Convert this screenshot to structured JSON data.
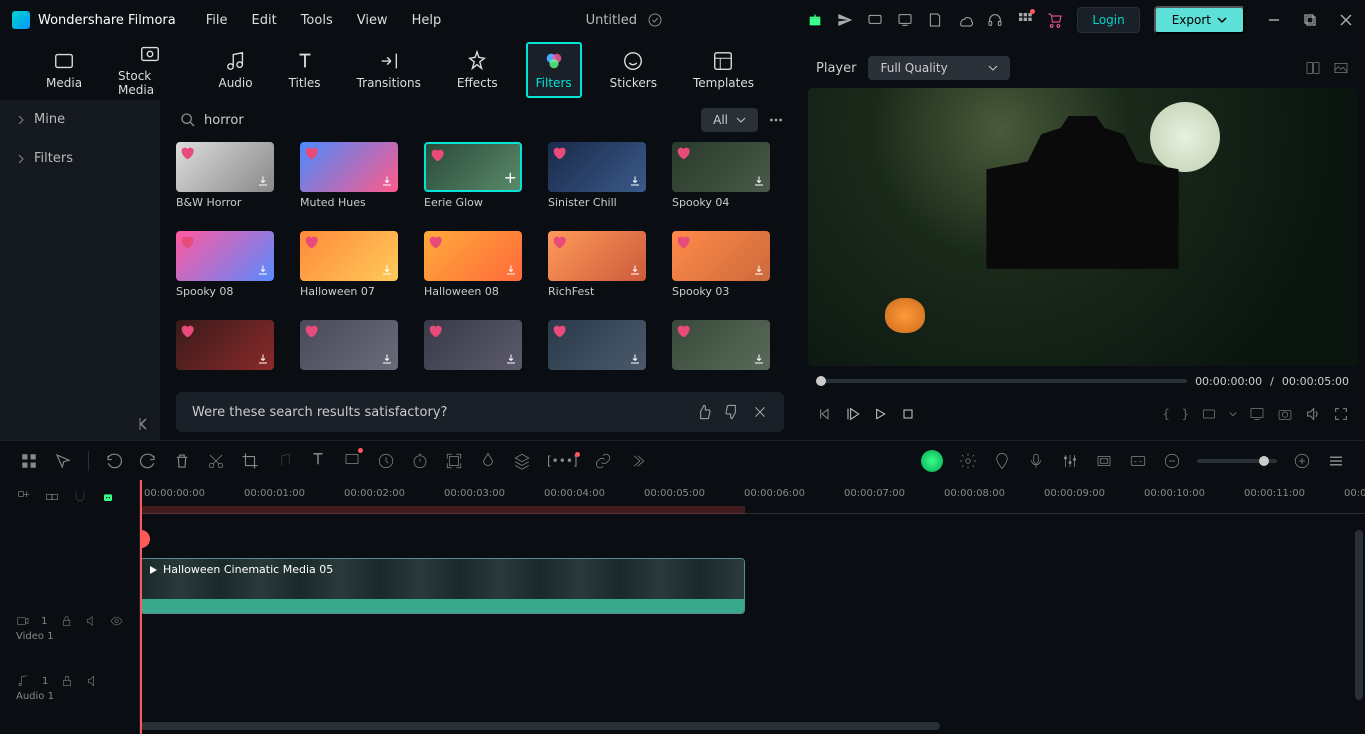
{
  "app": {
    "name": "Wondershare Filmora"
  },
  "menu": {
    "file": "File",
    "edit": "Edit",
    "tools": "Tools",
    "view": "View",
    "help": "Help"
  },
  "project": {
    "title": "Untitled"
  },
  "header": {
    "login": "Login",
    "export": "Export"
  },
  "tabs": {
    "media": "Media",
    "stock_media": "Stock Media",
    "audio": "Audio",
    "titles": "Titles",
    "transitions": "Transitions",
    "effects": "Effects",
    "filters": "Filters",
    "stickers": "Stickers",
    "templates": "Templates"
  },
  "sidebar": {
    "mine": "Mine",
    "filters": "Filters"
  },
  "search": {
    "query": "horror",
    "filter_all": "All"
  },
  "filters_grid": [
    {
      "label": "B&W Horror"
    },
    {
      "label": "Muted Hues"
    },
    {
      "label": "Eerie Glow",
      "selected": true
    },
    {
      "label": "Sinister Chill"
    },
    {
      "label": "Spooky 04"
    },
    {
      "label": "Spooky 08"
    },
    {
      "label": "Halloween 07"
    },
    {
      "label": "Halloween 08"
    },
    {
      "label": "RichFest"
    },
    {
      "label": "Spooky 03"
    },
    {
      "label": ""
    },
    {
      "label": ""
    },
    {
      "label": ""
    },
    {
      "label": ""
    },
    {
      "label": ""
    }
  ],
  "feedback": {
    "text": "Were these search results satisfactory?"
  },
  "preview": {
    "label": "Player",
    "quality": "Full Quality",
    "current": "00:00:00:00",
    "sep": "/",
    "total": "00:00:05:00"
  },
  "timeline": {
    "ticks": [
      "00:00:00:00",
      "00:00:01:00",
      "00:00:02:00",
      "00:00:03:00",
      "00:00:04:00",
      "00:00:05:00",
      "00:00:06:00",
      "00:00:07:00",
      "00:00:08:00",
      "00:00:09:00",
      "00:00:10:00",
      "00:00:11:00",
      "00:0"
    ],
    "video_track": {
      "num": "1",
      "label": "Video 1"
    },
    "audio_track": {
      "num": "1",
      "label": "Audio 1"
    },
    "clip": {
      "title": "Halloween Cinematic Media 05"
    }
  }
}
